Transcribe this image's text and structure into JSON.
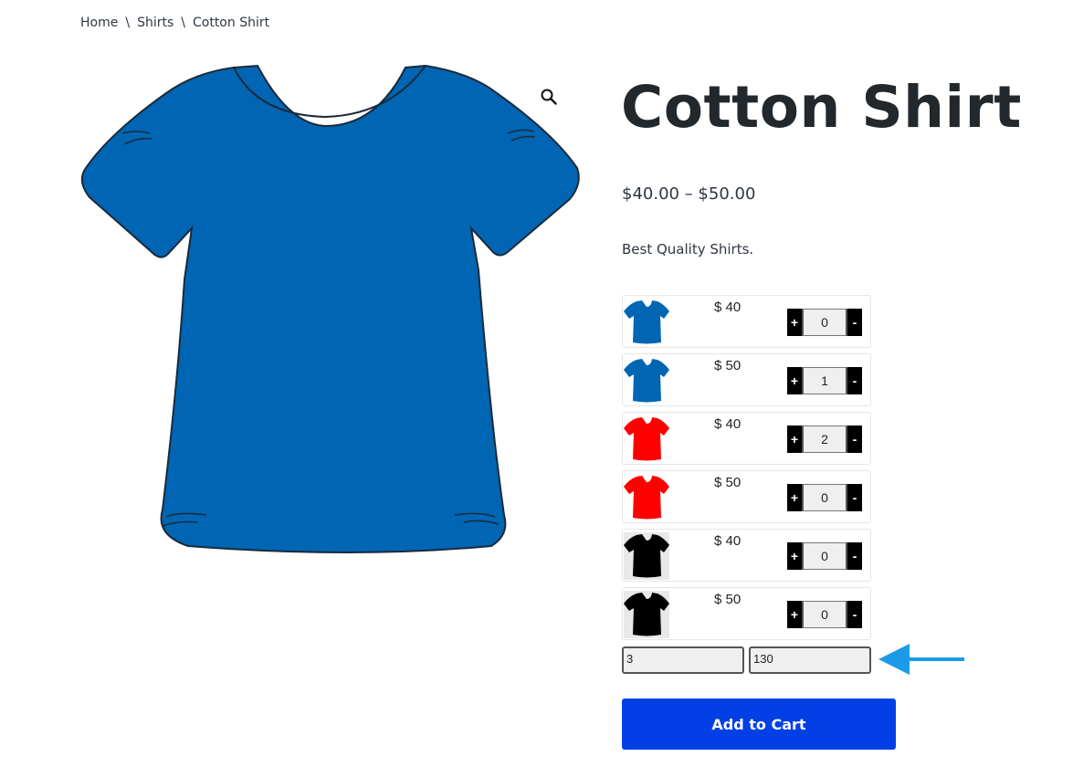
{
  "breadcrumb": [
    {
      "label": "Home"
    },
    {
      "label": "Shirts"
    },
    {
      "label": "Cotton Shirt"
    }
  ],
  "breadcrumb_separator": "\\",
  "product": {
    "title": "Cotton Shirt",
    "price_range": "$40.00 – $50.00",
    "description": "Best Quality Shirts.",
    "main_image_color": "#0066b3"
  },
  "variations": [
    {
      "color": "#0066b3",
      "price": "$ 40",
      "qty": "0"
    },
    {
      "color": "#0066b3",
      "price": "$ 50",
      "qty": "1"
    },
    {
      "color": "#ff0000",
      "price": "$ 40",
      "qty": "2"
    },
    {
      "color": "#ff0000",
      "price": "$ 50",
      "qty": "0"
    },
    {
      "color": "#000000",
      "price": "$ 40",
      "qty": "0"
    },
    {
      "color": "#000000",
      "price": "$ 50",
      "qty": "0"
    }
  ],
  "qty_controls": {
    "plus": "+",
    "minus": "-"
  },
  "totals": {
    "quantity": "3",
    "amount": "130"
  },
  "add_to_cart_label": "Add to Cart",
  "colors": {
    "button": "#0240e6",
    "arrow": "#1a9be8"
  },
  "icons": {
    "zoom": "magnifier-icon",
    "arrow": "arrow-left-icon"
  }
}
